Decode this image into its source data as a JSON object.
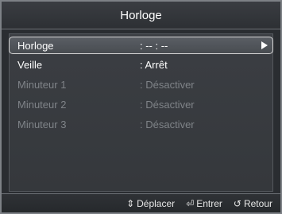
{
  "window": {
    "title": "Horloge"
  },
  "menu": {
    "items": [
      {
        "label": "Horloge",
        "value": ": -- : --",
        "state": "selected",
        "arrow": "right-arrow-icon"
      },
      {
        "label": "Veille",
        "value": ": Arrêt",
        "state": "active"
      },
      {
        "label": "Minuteur 1",
        "value": ": Désactiver",
        "state": "disabled"
      },
      {
        "label": "Minuteur 2",
        "value": ": Désactiver",
        "state": "disabled"
      },
      {
        "label": "Minuteur 3",
        "value": ": Désactiver",
        "state": "disabled"
      }
    ]
  },
  "footer": {
    "move": {
      "icon": "up-down-arrow-icon",
      "glyph": "⇕",
      "label": "Déplacer"
    },
    "enter": {
      "icon": "enter-icon",
      "glyph": "⏎",
      "label": "Entrer"
    },
    "back": {
      "icon": "return-icon",
      "glyph": "↺",
      "label": "Retour"
    }
  },
  "colors": {
    "background": "#2a2d31",
    "text_active": "#ffffff",
    "text_disabled": "#7f8388",
    "highlight_border": "#d8d8d8"
  }
}
